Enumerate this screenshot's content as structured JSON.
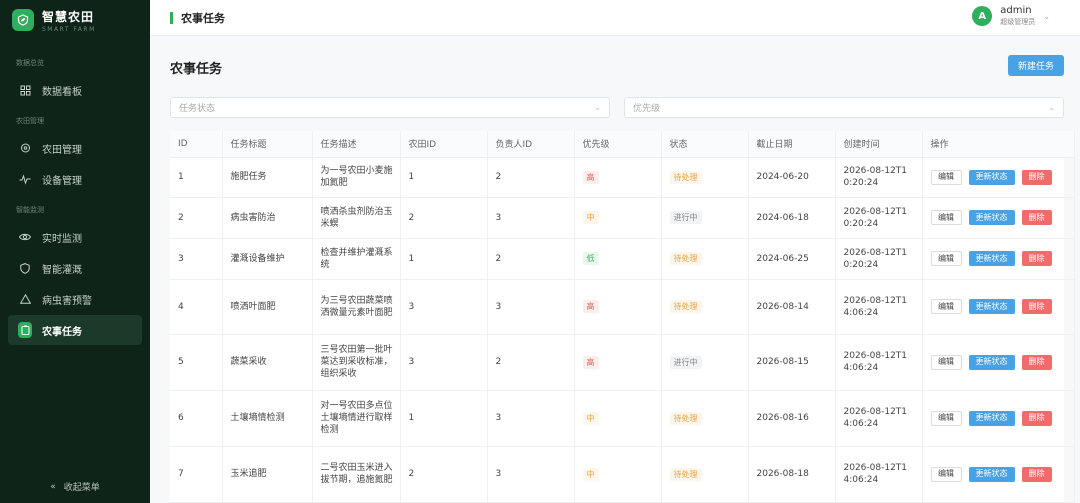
{
  "brand": {
    "title": "智慧农田",
    "subtitle": "SMART FARM"
  },
  "sidebar": {
    "sections": [
      {
        "label": "数据总览",
        "items": [
          {
            "label": "数据看板",
            "icon": "grid-icon"
          }
        ]
      },
      {
        "label": "农田管理",
        "items": [
          {
            "label": "农田管理",
            "icon": "location-icon"
          },
          {
            "label": "设备管理",
            "icon": "pulse-icon"
          }
        ]
      },
      {
        "label": "智能监测",
        "items": [
          {
            "label": "实时监测",
            "icon": "eye-icon"
          },
          {
            "label": "智能灌溉",
            "icon": "shield-icon"
          },
          {
            "label": "病虫害预警",
            "icon": "warning-icon"
          },
          {
            "label": "农事任务",
            "icon": "clipboard-icon",
            "active": true
          }
        ]
      }
    ],
    "collapse_label": "收起菜单"
  },
  "header": {
    "title": "农事任务"
  },
  "user": {
    "avatar_letter": "A",
    "name": "admin",
    "role": "超级管理员"
  },
  "main": {
    "title": "农事任务",
    "new_button": "新建任务",
    "filter_status_placeholder": "任务状态",
    "filter_priority_placeholder": "优先级"
  },
  "table": {
    "columns": [
      "ID",
      "任务标题",
      "任务描述",
      "农田ID",
      "负责人ID",
      "优先级",
      "状态",
      "截止日期",
      "创建时间",
      "操作"
    ],
    "rows": [
      {
        "id": "1",
        "title": "施肥任务",
        "desc": "为一号农田小麦施加氮肥",
        "field_id": "1",
        "owner_id": "2",
        "priority": "高",
        "priority_level": "high",
        "status": "待处理",
        "status_key": "pending",
        "deadline": "2024-06-20",
        "created": "2026-08-12T10:20:24"
      },
      {
        "id": "2",
        "title": "病虫害防治",
        "desc": "喷洒杀虫剂防治玉米螟",
        "field_id": "2",
        "owner_id": "3",
        "priority": "中",
        "priority_level": "mid",
        "status": "进行中",
        "status_key": "doing",
        "deadline": "2024-06-18",
        "created": "2026-08-12T10:20:24"
      },
      {
        "id": "3",
        "title": "灌溉设备维护",
        "desc": "检查并维护灌溉系统",
        "field_id": "1",
        "owner_id": "2",
        "priority": "低",
        "priority_level": "low",
        "status": "待处理",
        "status_key": "pending",
        "deadline": "2024-06-25",
        "created": "2026-08-12T10:20:24"
      },
      {
        "id": "4",
        "title": "喷洒叶面肥",
        "desc": "为三号农田蔬菜喷洒微量元素叶面肥",
        "field_id": "3",
        "owner_id": "3",
        "priority": "高",
        "priority_level": "high",
        "status": "待处理",
        "status_key": "pending",
        "deadline": "2026-08-14",
        "created": "2026-08-12T14:06:24"
      },
      {
        "id": "5",
        "title": "蔬菜采收",
        "desc": "三号农田第一批叶菜达到采收标准，组织采收",
        "field_id": "3",
        "owner_id": "2",
        "priority": "高",
        "priority_level": "high",
        "status": "进行中",
        "status_key": "doing",
        "deadline": "2026-08-15",
        "created": "2026-08-12T14:06:24"
      },
      {
        "id": "6",
        "title": "土壤墒情检测",
        "desc": "对一号农田多点位土壤墒情进行取样检测",
        "field_id": "1",
        "owner_id": "3",
        "priority": "中",
        "priority_level": "mid",
        "status": "待处理",
        "status_key": "pending",
        "deadline": "2026-08-16",
        "created": "2026-08-12T14:06:24"
      },
      {
        "id": "7",
        "title": "玉米追肥",
        "desc": "二号农田玉米进入拔节期，追施氮肥",
        "field_id": "2",
        "owner_id": "3",
        "priority": "中",
        "priority_level": "mid",
        "status": "待处理",
        "status_key": "pending",
        "deadline": "2026-08-18",
        "created": "2026-08-12T14:06:24"
      }
    ],
    "actions": {
      "edit": "编辑",
      "update_status": "更新状态",
      "delete": "删除"
    }
  },
  "colors": {
    "brand_green": "#2fae5e",
    "sidebar_bg": "#0f2418",
    "primary_blue": "#4aa2e6",
    "danger_red": "#f06b6b"
  }
}
